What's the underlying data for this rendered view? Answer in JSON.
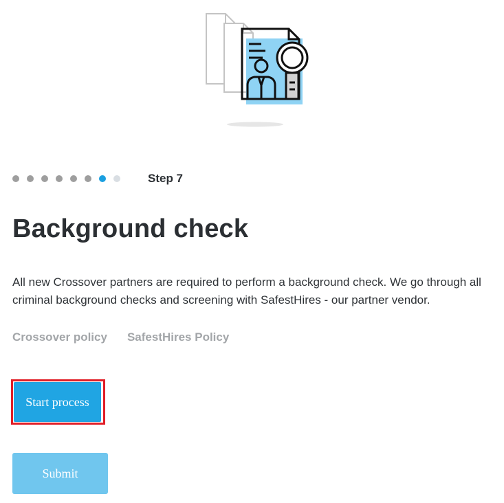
{
  "illustration": {
    "icon": "background-check-document-magnifier-icon",
    "colors": {
      "accent": "#8fd3f4",
      "outline": "#111111",
      "page_outline": "#c4c4c4"
    }
  },
  "stepper": {
    "total_dots": 8,
    "current_index": 6,
    "label": "Step 7",
    "colors": {
      "completed": "#9e9e9e",
      "active": "#1a9fe0",
      "upcoming": "#d9dee3"
    }
  },
  "page": {
    "title": "Background check",
    "description": "All new Crossover partners are required to perform a background check. We go through all criminal background checks and screening with SafestHires - our partner vendor."
  },
  "links": {
    "crossover_policy": "Crossover policy",
    "safesthires_policy": "SafestHires Policy"
  },
  "buttons": {
    "start_process": "Start process",
    "submit": "Submit"
  },
  "colors": {
    "primary": "#20a5e3",
    "primary_disabled": "#70c6ee",
    "highlight": "#e01e27",
    "link_muted": "#a3a6a9"
  }
}
